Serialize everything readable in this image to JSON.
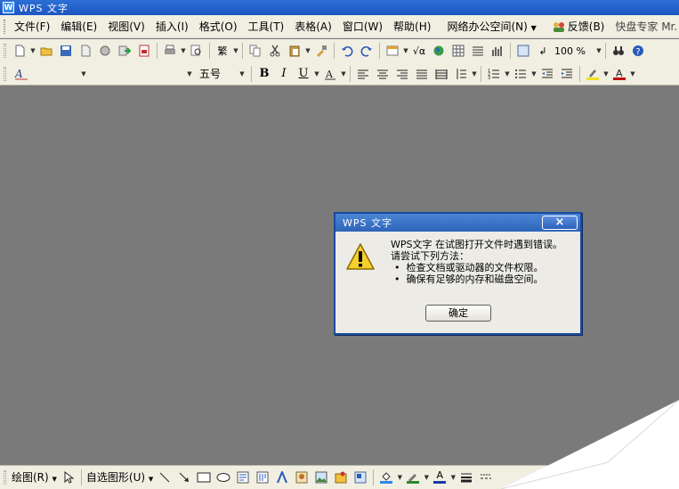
{
  "window": {
    "title": "WPS 文字",
    "app_icon_letter": "W"
  },
  "menubar": {
    "items": [
      "文件(F)",
      "编辑(E)",
      "视图(V)",
      "插入(I)",
      "格式(O)",
      "工具(T)",
      "表格(A)",
      "窗口(W)",
      "帮助(H)"
    ],
    "network_office": "网络办公空间(N)",
    "feedback": "反馈(B)",
    "kuaipan": "快盘专家 Mr. K 说"
  },
  "toolbar1": {
    "traditional_label": "繁",
    "zoom_value": "100 %"
  },
  "toolbar2": {
    "font_size": "五号",
    "bold": "B",
    "italic": "I",
    "underline": "U",
    "font_color_letter": "A"
  },
  "dialog": {
    "title": "WPS 文字",
    "close_label": "×",
    "line1": "WPS文字 在试图打开文件时遇到错误。",
    "line2": "请尝试下列方法：",
    "bullet1": "检查文档或驱动器的文件权限。",
    "bullet2": "确保有足够的内存和磁盘空间。",
    "ok_label": "确定"
  },
  "drawbar": {
    "draw_label": "绘图(R)",
    "autoshape_label": "自选图形(U)",
    "font_color_letter": "A"
  },
  "colors": {
    "titlebar": "#1b56c2",
    "workspace": "#7a7a7a",
    "toolbar_bg": "#f1efe2",
    "dialog_border": "#1b4a9c"
  }
}
